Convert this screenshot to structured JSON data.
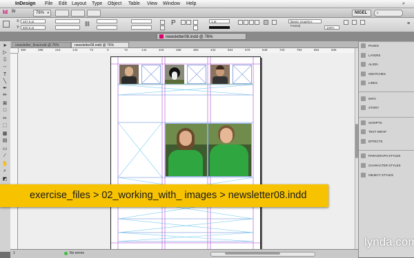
{
  "menubar": {
    "app": "InDesign",
    "items": [
      "File",
      "Edit",
      "Layout",
      "Type",
      "Object",
      "Table",
      "View",
      "Window",
      "Help"
    ]
  },
  "appbar": {
    "zoom": "76%",
    "workspace": "NIGEL"
  },
  "control": {
    "x": "467.5 pt",
    "y": "600.5 pt",
    "stroke_weight": "1 pt",
    "opacity": "100%",
    "object_style": "[Basic Graphics Frame]"
  },
  "document": {
    "tabs": [
      {
        "label": "newsletter_final.indd @ 76%",
        "active": false
      },
      {
        "label": "newsletter08.indd @ 76%",
        "active": true
      }
    ],
    "window_title": "newsletter08.indd @ 76%",
    "ruler_numbers": [
      "360",
      "288",
      "216",
      "144",
      "72",
      "0",
      "72",
      "144",
      "216",
      "288",
      "360",
      "432",
      "504",
      "576",
      "648",
      "720",
      "792",
      "864",
      "936"
    ],
    "page_number": "1",
    "status": "No errors"
  },
  "panels": {
    "group1": [
      "PAGES",
      "LAYERS",
      "ALIGN",
      "SWATCHES",
      "LINKS"
    ],
    "group2": [
      "INFO",
      "STORY"
    ],
    "group3": [
      "SCRIPTS",
      "TEXT WRAP",
      "EFFECTS"
    ],
    "group4": [
      "PARAGRAPH STYLES",
      "CHARACTER STYLES",
      "OBJECT STYLES"
    ]
  },
  "banner": {
    "path": "exercise_files > 02_working_with_ images > newsletter08.indd"
  },
  "watermark": "lynda.com",
  "colors": {
    "banner": "#f7c200",
    "frame_edge": "#8ba8e0",
    "guide_magenta": "#c070e0",
    "guide_cyan": "#6ec8f0"
  }
}
